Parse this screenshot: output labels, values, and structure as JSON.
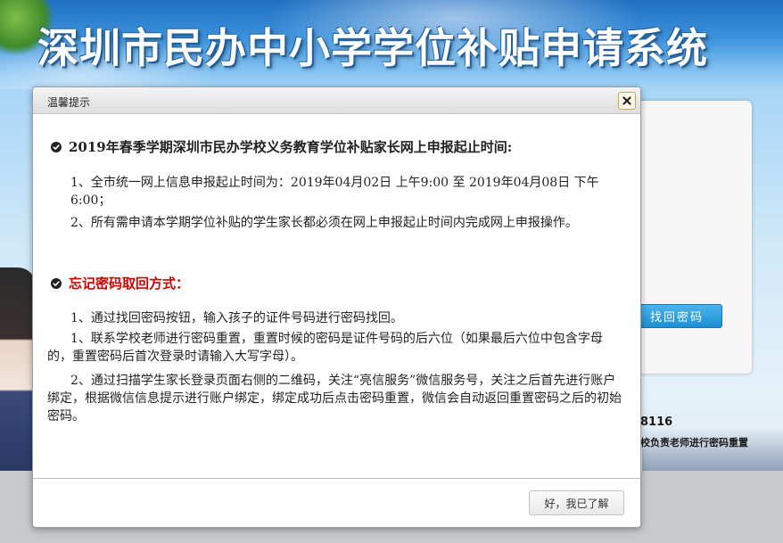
{
  "site": {
    "title": "深圳市民办中小学学位补贴申请系统",
    "recover_button_label": "找回密码",
    "phone_fragment": "8116",
    "contact_fragment": "校负责老师进行密码重置"
  },
  "dialog": {
    "title": "温馨提示",
    "close_icon": "close-icon",
    "section1": {
      "heading": "2019年春季学期深圳市民办学校义务教育学位补贴家长网上申报起止时间:",
      "lines": [
        "1、全市统一网上信息申报起止时间为：2019年04月02日 上午9:00 至 2019年04月08日 下午6:00；",
        "2、所有需申请本学期学位补贴的学生家长都必须在网上申报起止时间内完成网上申报操作。"
      ]
    },
    "section2": {
      "heading": "忘记密码取回方式：",
      "heading_color": "#d40000",
      "lines": [
        "1、通过找回密码按钮，输入孩子的证件号码进行密码找回。",
        "1、联系学校老师进行密码重置，重置时候的密码是证件号码的后六位（如果最后六位中包含字母的，重置密码后首次登录时请输入大写字母）。",
        "2、通过扫描学生家长登录页面右侧的二维码，关注“亮信服务”微信服务号，关注之后首先进行账户绑定，根据微信信息提示进行账户绑定，绑定成功后点击密码重置，微信会自动返回重置密码之后的初始密码。"
      ]
    },
    "ok_button_label": "好，我已了解"
  }
}
